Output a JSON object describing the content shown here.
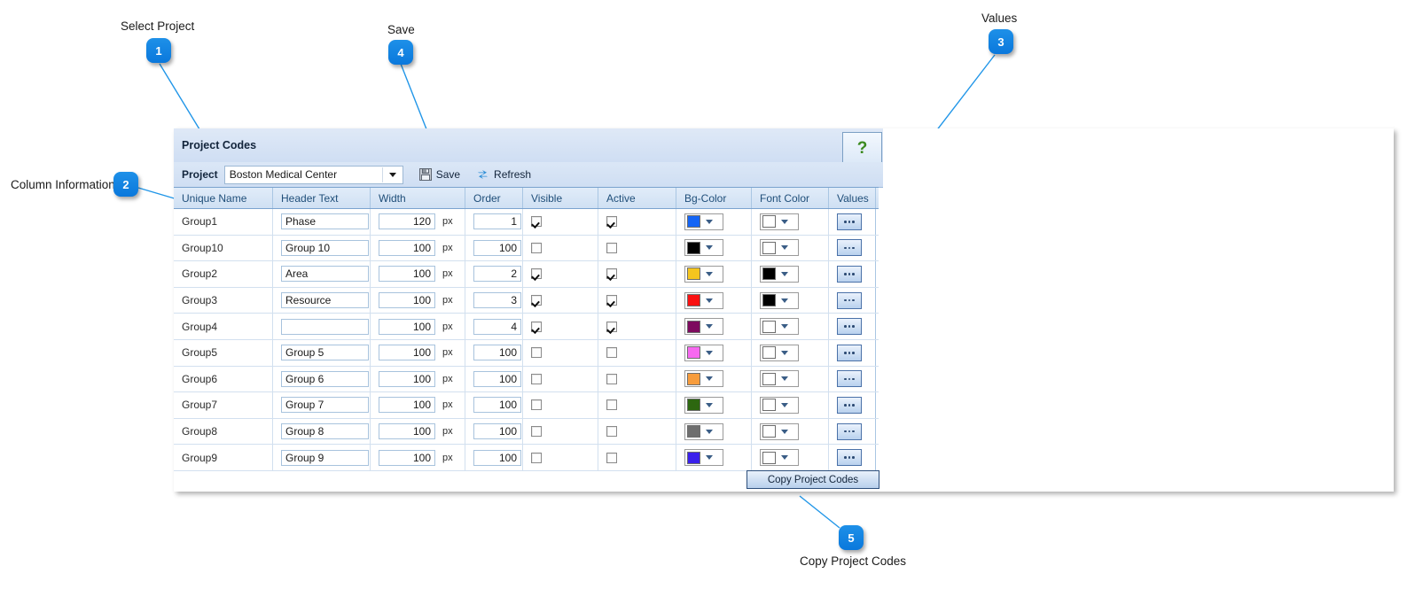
{
  "panel": {
    "title": "Project Codes",
    "help_label": "?",
    "toolbar": {
      "project_label": "Project",
      "project_value": "Boston Medical Center",
      "save_label": "Save",
      "refresh_label": "Refresh"
    },
    "copy_button_label": "Copy Project Codes"
  },
  "grid": {
    "columns": [
      "Unique Name",
      "Header Text",
      "Width",
      "Order",
      "Visible",
      "Active",
      "Bg-Color",
      "Font Color",
      "Values"
    ],
    "unit_label": "px",
    "rows": [
      {
        "name": "Group1",
        "header": "Phase",
        "width": "120",
        "order": "1",
        "visible": true,
        "active": true,
        "bg": "#1565f5",
        "font": "#ffffff"
      },
      {
        "name": "Group10",
        "header": "Group 10",
        "width": "100",
        "order": "100",
        "visible": false,
        "active": false,
        "bg": "#000000",
        "font": "#ffffff"
      },
      {
        "name": "Group2",
        "header": "Area",
        "width": "100",
        "order": "2",
        "visible": true,
        "active": true,
        "bg": "#f5c51e",
        "font": "#000000"
      },
      {
        "name": "Group3",
        "header": "Resource",
        "width": "100",
        "order": "3",
        "visible": true,
        "active": true,
        "bg": "#fa1111",
        "font": "#000000"
      },
      {
        "name": "Group4",
        "header": "",
        "width": "100",
        "order": "4",
        "visible": true,
        "active": true,
        "bg": "#7d0a5e",
        "font": "#ffffff"
      },
      {
        "name": "Group5",
        "header": "Group 5",
        "width": "100",
        "order": "100",
        "visible": false,
        "active": false,
        "bg": "#f768f0",
        "font": "#ffffff"
      },
      {
        "name": "Group6",
        "header": "Group 6",
        "width": "100",
        "order": "100",
        "visible": false,
        "active": false,
        "bg": "#f79c3c",
        "font": "#ffffff"
      },
      {
        "name": "Group7",
        "header": "Group 7",
        "width": "100",
        "order": "100",
        "visible": false,
        "active": false,
        "bg": "#2d6710",
        "font": "#ffffff"
      },
      {
        "name": "Group8",
        "header": "Group 8",
        "width": "100",
        "order": "100",
        "visible": false,
        "active": false,
        "bg": "#6e6e6e",
        "font": "#ffffff"
      },
      {
        "name": "Group9",
        "header": "Group 9",
        "width": "100",
        "order": "100",
        "visible": false,
        "active": false,
        "bg": "#3a20eb",
        "font": "#ffffff"
      }
    ]
  },
  "annotations": {
    "accent_color": "#1283e2",
    "items": [
      {
        "number": "1",
        "label": "Select Project"
      },
      {
        "number": "2",
        "label": "Column Information"
      },
      {
        "number": "3",
        "label": "Values"
      },
      {
        "number": "4",
        "label": "Save"
      },
      {
        "number": "5",
        "label": "Copy Project Codes"
      }
    ]
  }
}
